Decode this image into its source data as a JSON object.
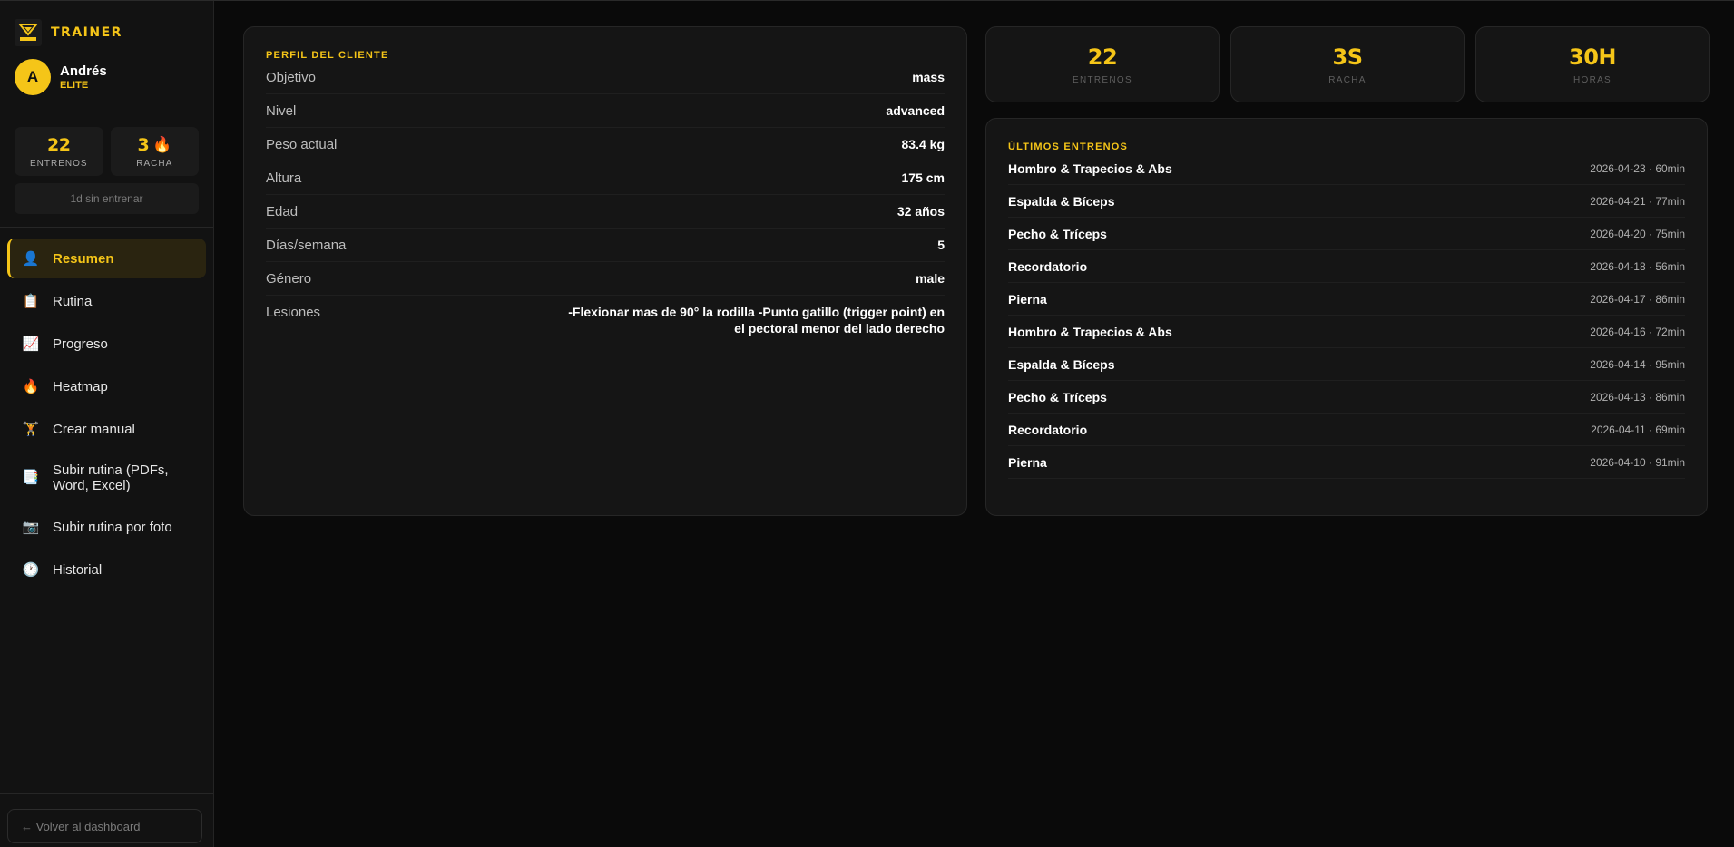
{
  "brand": {
    "name": "TRAINER",
    "logo_text": "TRAINER"
  },
  "user": {
    "initial": "A",
    "name": "Andrés",
    "tier": "ELITE"
  },
  "sidebar_stats": {
    "workouts_value": "22",
    "workouts_label": "ENTRENOS",
    "streak_value": "3",
    "streak_label": "RACHA",
    "inactive_text": "1d sin entrenar"
  },
  "nav": {
    "items": [
      {
        "label": "Resumen",
        "icon": "person-icon",
        "glyph": "👤"
      },
      {
        "label": "Rutina",
        "icon": "clipboard-icon",
        "glyph": "📋"
      },
      {
        "label": "Progreso",
        "icon": "chart-icon",
        "glyph": "📈"
      },
      {
        "label": "Heatmap",
        "icon": "fire-icon",
        "glyph": "🔥"
      },
      {
        "label": "Crear manual",
        "icon": "mannequin-icon",
        "glyph": "🏋"
      },
      {
        "label": "Subir rutina (PDFs, Word, Excel)",
        "icon": "document-icon",
        "glyph": "📑"
      },
      {
        "label": "Subir rutina por foto",
        "icon": "camera-icon",
        "glyph": "📷"
      },
      {
        "label": "Historial",
        "icon": "clock-icon",
        "glyph": "🕐"
      }
    ],
    "active_index": 0
  },
  "back_button": "← Volver al dashboard",
  "profile": {
    "title": "PERFIL DEL CLIENTE",
    "rows": [
      {
        "label": "Objetivo",
        "value": "mass"
      },
      {
        "label": "Nivel",
        "value": "advanced"
      },
      {
        "label": "Peso actual",
        "value": "83.4 kg"
      },
      {
        "label": "Altura",
        "value": "175 cm"
      },
      {
        "label": "Edad",
        "value": "32 años"
      },
      {
        "label": "Días/semana",
        "value": "5"
      },
      {
        "label": "Género",
        "value": "male"
      },
      {
        "label": "Lesiones",
        "value": "-Flexionar mas de 90° la rodilla -Punto gatillo (trigger point) en el pectoral menor del lado derecho"
      }
    ]
  },
  "stats": [
    {
      "value": "22",
      "label": "ENTRENOS"
    },
    {
      "value": "3S",
      "label": "RACHA"
    },
    {
      "value": "30H",
      "label": "HORAS"
    }
  ],
  "workouts": {
    "title": "ÚLTIMOS ENTRENOS",
    "items": [
      {
        "name": "Hombro & Trapecios & Abs",
        "meta": "2026-04-23 · 60min"
      },
      {
        "name": "Espalda & Bíceps",
        "meta": "2026-04-21 · 77min"
      },
      {
        "name": "Pecho & Tríceps",
        "meta": "2026-04-20 · 75min"
      },
      {
        "name": "Recordatorio",
        "meta": "2026-04-18 · 56min"
      },
      {
        "name": "Pierna",
        "meta": "2026-04-17 · 86min"
      },
      {
        "name": "Hombro & Trapecios & Abs",
        "meta": "2026-04-16 · 72min"
      },
      {
        "name": "Espalda & Bíceps",
        "meta": "2026-04-14 · 95min"
      },
      {
        "name": "Pecho & Tríceps",
        "meta": "2026-04-13 · 86min"
      },
      {
        "name": "Recordatorio",
        "meta": "2026-04-11 · 69min"
      },
      {
        "name": "Pierna",
        "meta": "2026-04-10 · 91min"
      }
    ]
  },
  "colors": {
    "accent": "#f5c518",
    "background": "#0a0a0a",
    "card": "#151515"
  }
}
